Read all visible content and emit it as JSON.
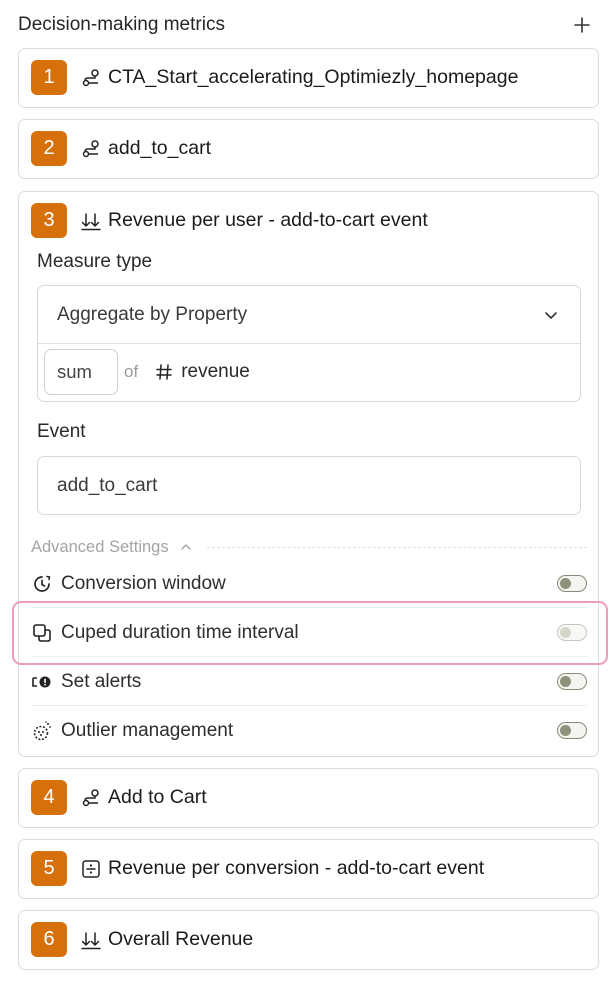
{
  "header": {
    "title": "Decision-making metrics",
    "add_icon": "plus-icon"
  },
  "metrics": [
    {
      "index": "1",
      "icon": "conversion-path-icon",
      "name": "CTA_Start_accelerating_Optimiezly_homepage"
    },
    {
      "index": "2",
      "icon": "conversion-path-icon",
      "name": "add_to_cart"
    },
    {
      "index": "3",
      "icon": "sort-descending-icon",
      "name": "Revenue per user - add-to-cart event"
    },
    {
      "index": "4",
      "icon": "conversion-path-icon",
      "name": "Add to Cart"
    },
    {
      "index": "5",
      "icon": "divide-square-icon",
      "name": "Revenue per conversion - add-to-cart event"
    },
    {
      "index": "6",
      "icon": "sort-descending-icon",
      "name": "Overall Revenue"
    }
  ],
  "expanded": {
    "measure_type_label": "Measure type",
    "measure_type_value": "Aggregate by Property",
    "aggregation": "sum",
    "of_text": "of",
    "property_icon": "hash-icon",
    "property": "revenue",
    "event_label": "Event",
    "event_value": "add_to_cart",
    "advanced_settings_label": "Advanced Settings",
    "settings": [
      {
        "icon": "clock-icon",
        "label": "Conversion window",
        "state": "off",
        "enabled": true
      },
      {
        "icon": "copy-icon",
        "label": "Cuped duration time interval",
        "state": "off",
        "enabled": false
      },
      {
        "icon": "alert-icon",
        "label": "Set alerts",
        "state": "off",
        "enabled": true
      },
      {
        "icon": "outlier-icon",
        "label": "Outlier management",
        "state": "off",
        "enabled": true
      }
    ]
  },
  "colors": {
    "badge": "#d5700b",
    "highlight": "#ef9cbc",
    "toggle_knob": "#8d927a"
  }
}
